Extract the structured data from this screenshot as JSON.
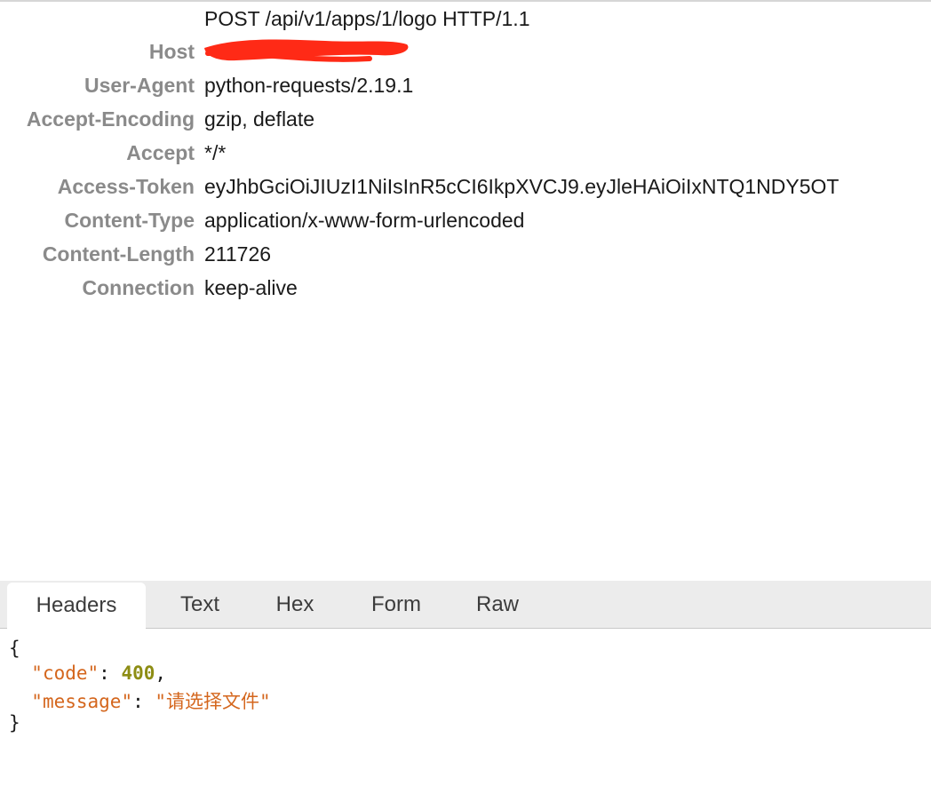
{
  "request": {
    "request_line": "POST /api/v1/apps/1/logo HTTP/1.1",
    "headers": [
      {
        "name": "Host",
        "value": ""
      },
      {
        "name": "User-Agent",
        "value": "python-requests/2.19.1"
      },
      {
        "name": "Accept-Encoding",
        "value": "gzip, deflate"
      },
      {
        "name": "Accept",
        "value": "*/*"
      },
      {
        "name": "Access-Token",
        "value": "eyJhbGciOiJIUzI1NiIsInR5cCI6IkpXVCJ9.eyJleHAiOiIxNTQ1NDY5OT"
      },
      {
        "name": "Content-Type",
        "value": "application/x-www-form-urlencoded"
      },
      {
        "name": "Content-Length",
        "value": "211726"
      },
      {
        "name": "Connection",
        "value": "keep-alive"
      }
    ],
    "redaction_color": "#ff2a16"
  },
  "tabs": [
    {
      "label": "Headers",
      "active": true
    },
    {
      "label": "Text",
      "active": false
    },
    {
      "label": "Hex",
      "active": false
    },
    {
      "label": "Form",
      "active": false
    },
    {
      "label": "Raw",
      "active": false
    }
  ],
  "response": {
    "open_brace": "{",
    "close_brace": "}",
    "fields": [
      {
        "key": "\"code\"",
        "value": "400",
        "type": "number",
        "trailing": ","
      },
      {
        "key": "\"message\"",
        "value": "\"请选择文件\"",
        "type": "string",
        "trailing": ""
      }
    ],
    "colors": {
      "key": "#d4661d",
      "number": "#8d8d14",
      "string": "#d4661d"
    }
  }
}
